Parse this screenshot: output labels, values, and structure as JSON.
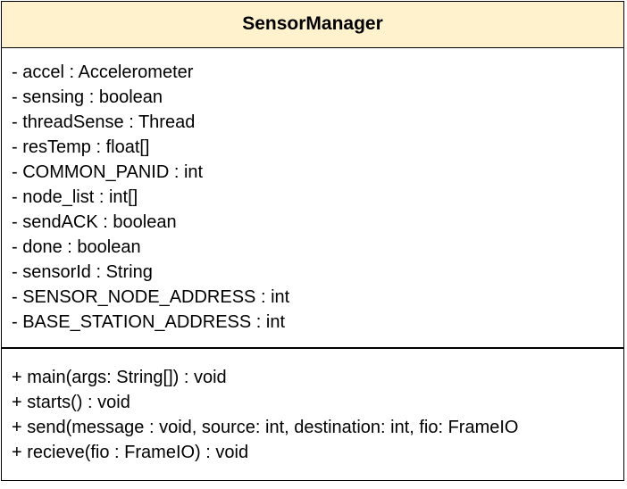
{
  "class_name": "SensorManager",
  "attributes": [
    "- accel : Accelerometer",
    "- sensing : boolean",
    "- threadSense : Thread",
    "- resTemp : float[]",
    "- COMMON_PANID : int",
    "- node_list : int[]",
    "- sendACK : boolean",
    "- done : boolean",
    "- sensorId : String",
    "- SENSOR_NODE_ADDRESS : int",
    "- BASE_STATION_ADDRESS : int"
  ],
  "operations": [
    "+ main(args: String[]) : void",
    "+ starts() : void",
    "+ send(message : void, source: int, destination: int, fio: FrameIO",
    "+ recieve(fio : FrameIO) : void"
  ],
  "colors": {
    "header_fill": "#fff2cc",
    "border": "#000000",
    "body_fill": "#ffffff"
  }
}
